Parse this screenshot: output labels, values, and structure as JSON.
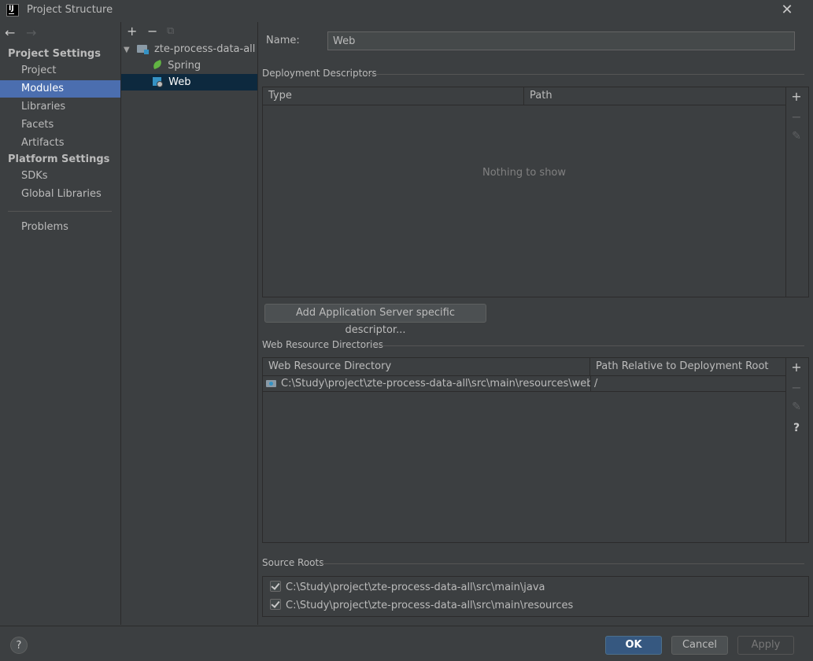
{
  "window": {
    "title": "Project Structure",
    "close_glyph": "✕",
    "icon_text": "IJ"
  },
  "nav": {
    "back_glyph": "←",
    "forward_glyph": "→",
    "project_settings_heading": "Project Settings",
    "project_items": [
      "Project",
      "Modules",
      "Libraries",
      "Facets",
      "Artifacts"
    ],
    "selected_item": "Modules",
    "platform_settings_heading": "Platform Settings",
    "platform_items": [
      "SDKs",
      "Global Libraries"
    ],
    "problems": "Problems"
  },
  "tree": {
    "add_glyph": "+",
    "remove_glyph": "−",
    "copy_glyph": "⧉",
    "expand_glyph": "▼",
    "root": "zte-process-data-all",
    "children": [
      "Spring",
      "Web"
    ],
    "selected": "Web"
  },
  "content": {
    "name_label": "Name:",
    "name_value": "Web",
    "deployment_descriptors": {
      "title": "Deployment Descriptors",
      "columns": [
        "Type",
        "Path"
      ],
      "empty_text": "Nothing to show",
      "add_server_button": "Add Application Server specific descriptor..."
    },
    "web_resource_directories": {
      "title": "Web Resource Directories",
      "columns": [
        "Web Resource Directory",
        "Path Relative to Deployment Root"
      ],
      "rows": [
        {
          "directory": "C:\\Study\\project\\zte-process-data-all\\src\\main\\resources\\webapp",
          "path": "/"
        }
      ]
    },
    "source_roots": {
      "title": "Source Roots",
      "items": [
        {
          "path": "C:\\Study\\project\\zte-process-data-all\\src\\main\\java",
          "checked": true
        },
        {
          "path": "C:\\Study\\project\\zte-process-data-all\\src\\main\\resources",
          "checked": true
        }
      ]
    },
    "tools": {
      "add": "+",
      "remove": "−",
      "edit": "✎",
      "help": "?"
    }
  },
  "footer": {
    "help": "?",
    "ok": "OK",
    "cancel": "Cancel",
    "apply": "Apply"
  },
  "colors": {
    "background": "#3c3f41",
    "selection": "#4b6eaf",
    "tree_selection": "#0d293e",
    "primary_button": "#365880"
  }
}
